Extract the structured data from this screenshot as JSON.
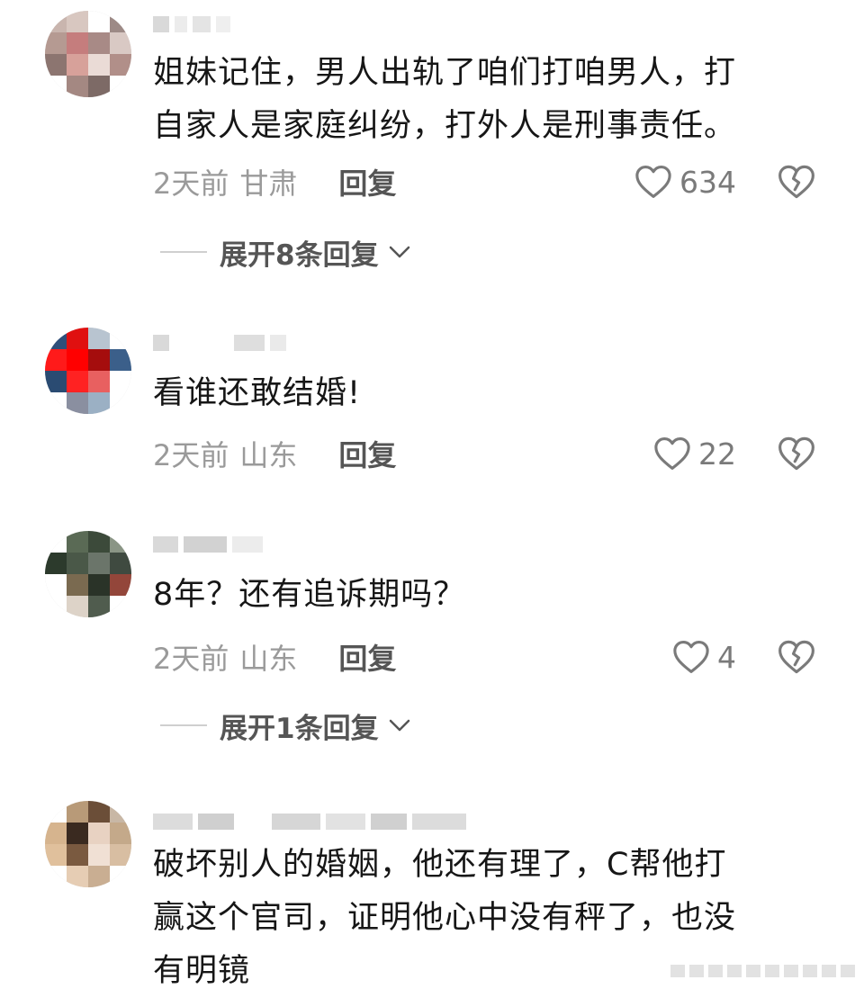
{
  "comments": [
    {
      "text": "姐妹记住，男人出轨了咱们打咱男人，打\n自家人是家庭纠纷，打外人是刑事责任。",
      "time": "2天前",
      "location": "甘肃",
      "reply_label": "回复",
      "likes": "634",
      "expand_label": "展开8条回复"
    },
    {
      "text": "看谁还敢结婚!",
      "time": "2天前",
      "location": "山东",
      "reply_label": "回复",
      "likes": "22"
    },
    {
      "text": "8年？还有追诉期吗？",
      "time": "2天前",
      "location": "山东",
      "reply_label": "回复",
      "likes": "4",
      "expand_label": "展开1条回复"
    },
    {
      "text": "破坏别人的婚姻，他还有理了，C帮他打\n赢这个官司，证明他心中没有秤了，也没\n有明镜"
    }
  ],
  "icons": {
    "like": "heart-outline-icon",
    "dislike": "broken-heart-icon",
    "expand": "chevron-down-icon"
  },
  "colors": {
    "text": "#161616",
    "meta": "#9a9a9a",
    "reply": "#555555"
  }
}
